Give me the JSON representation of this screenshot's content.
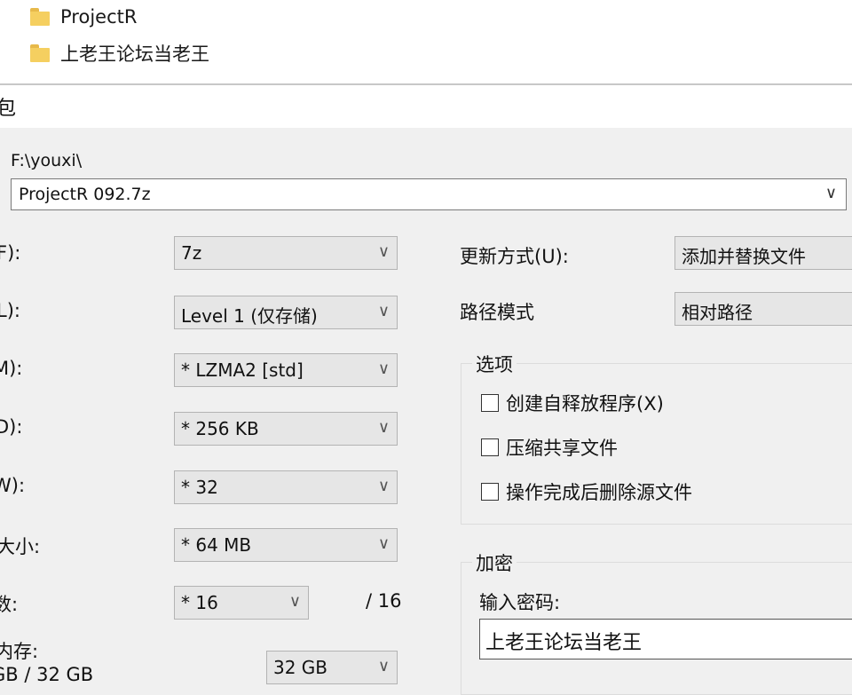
{
  "file_list": {
    "items": [
      {
        "name": "ProjectR",
        "icon": "folder-icon"
      },
      {
        "name": "上老王论坛当老王",
        "icon": "folder-icon"
      }
    ]
  },
  "dialog": {
    "title_partial": "包",
    "path": "F:\\youxi\\",
    "archive_name": "ProjectR 092.7z"
  },
  "left_fields": [
    {
      "label": "F):",
      "value": "7z"
    },
    {
      "label": "L):",
      "value": "Level 1 (仅存储)"
    },
    {
      "label": "M):",
      "value": "*  LZMA2 [std]"
    },
    {
      "label": "D):",
      "value": "*  256 KB"
    },
    {
      "label": "W):",
      "value": "*  32"
    },
    {
      "label": "大小:",
      "value": "*  64 MB"
    },
    {
      "label": "数:",
      "value": "*  16",
      "suffix": "/ 16"
    },
    {
      "label": "内存:",
      "sublabel": "GB / 32 GB",
      "value": "32 GB"
    }
  ],
  "right_fields": {
    "update_mode": {
      "label": "更新方式(U):",
      "value": "添加并替换文件"
    },
    "path_mode": {
      "label": "路径模式",
      "value": "相对路径"
    }
  },
  "options": {
    "title": "选项",
    "items": [
      {
        "label": "创建自释放程序(X)",
        "checked": false
      },
      {
        "label": "压缩共享文件",
        "checked": false
      },
      {
        "label": "操作完成后删除源文件",
        "checked": false
      }
    ]
  },
  "encryption": {
    "title": "加密",
    "password_label": "输入密码:",
    "password_value": "上老王论坛当老王"
  },
  "chevron": "∨"
}
